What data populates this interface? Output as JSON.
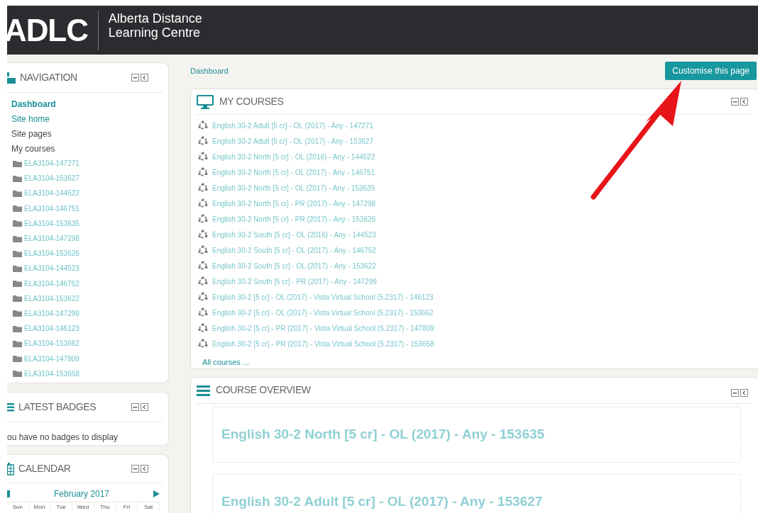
{
  "header": {
    "logo": "ADLC",
    "name_lines": [
      "Alberta Distance",
      "Learning Centre"
    ]
  },
  "breadcrumb": "Dashboard",
  "customise_button": "Customise this page",
  "navigation": {
    "title": "NAVIGATION",
    "items": [
      {
        "label": "Dashboard",
        "kind": "link",
        "selected": true
      },
      {
        "label": "Site home",
        "kind": "link",
        "selected": false
      },
      {
        "label": "Site pages",
        "kind": "branch",
        "selected": false
      },
      {
        "label": "My courses",
        "kind": "branch",
        "selected": false
      }
    ],
    "courses": [
      "ELA3104-147271",
      "ELA3104-153627",
      "ELA3104-144522",
      "ELA3104-146751",
      "ELA3104-153635",
      "ELA3104-147298",
      "ELA3104-153626",
      "ELA3104-144523",
      "ELA3104-146752",
      "ELA3104-153622",
      "ELA3104-147299",
      "ELA3104-146123",
      "ELA3104-153662",
      "ELA3104-147809",
      "ELA3104-153658"
    ]
  },
  "latest_badges": {
    "title": "LATEST BADGES",
    "message": "ou have no badges to display"
  },
  "calendar": {
    "title": "CALENDAR",
    "month": "February 2017",
    "weekdays": [
      "Sun",
      "Mon",
      "Tue",
      "Wed",
      "Thu",
      "Fri",
      "Sat"
    ]
  },
  "my_courses": {
    "title": "MY COURSES",
    "courses": [
      "English 30-2 Adult [5 cr] - OL (2017) - Any - 147271",
      "English 30-2 Adult [5 cr] - OL (2017) - Any - 153627",
      "English 30-2 North [5 cr] - OL (2016) - Any - 144522",
      "English 30-2 North [5 cr] - OL (2017) - Any - 146751",
      "English 30-2 North [5 cr] - OL (2017) - Any - 153635",
      "English 30-2 North [5 cr] - PR (2017) - Any - 147298",
      "English 30-2 North [5 cr] - PR (2017) - Any - 153626",
      "English 30-2 South [5 cr] - OL (2016) - Any - 144523",
      "English 30-2 South [5 cr] - OL (2017) - Any - 146752",
      "English 30-2 South [5 cr] - OL (2017) - Any - 153622",
      "English 30-2 South [5 cr] - PR (2017) - Any - 147299",
      "English 30-2 [5 cr] - OL (2017) - Vista Virtual School (5.2317) - 146123",
      "English 30-2 [5 cr] - OL (2017) - Vista Virtual School (5.2317) - 153662",
      "English 30-2 [5 cr] - PR (2017) - Vista Virtual School (5.2317) - 147809",
      "English 30-2 [5 cr] - PR (2017) - Vista Virtual School (5.2317) - 153658"
    ],
    "all_link": "All courses ..."
  },
  "course_overview": {
    "title": "COURSE OVERVIEW",
    "courses": [
      "English 30-2 North [5 cr] - OL (2017) - Any - 153635",
      "English 30-2 Adult [5 cr] - OL (2017) - Any - 153627"
    ]
  }
}
